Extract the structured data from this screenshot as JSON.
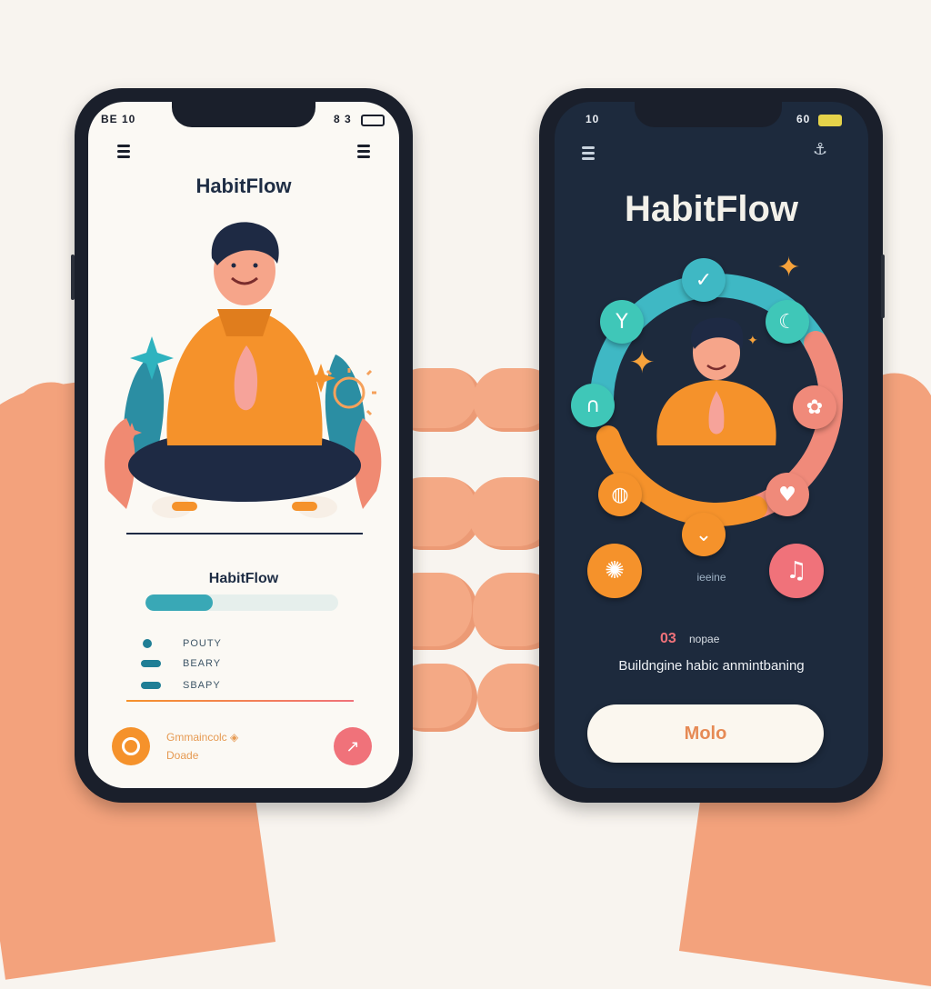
{
  "left_phone": {
    "status_time": "BE 10",
    "status_right": "8 3",
    "app_title": "HabitFlow",
    "section_title": "HabitFlow",
    "progress_fraction": 0.35,
    "list_items": [
      {
        "label": "POUTY"
      },
      {
        "label": "BEARY"
      },
      {
        "label": "SBAPY"
      }
    ],
    "footer_text_line1": "Gmmaincolc ◈",
    "footer_text_line2": "Doade",
    "icons": {
      "menu_left": "menu-icon",
      "menu_right": "menu-icon",
      "footer_left": "target-icon",
      "footer_right": "trend-icon"
    }
  },
  "right_phone": {
    "status_time": "10",
    "status_right": "60",
    "app_title": "HabitFlow",
    "ring_caption": "ieeine",
    "counter_text": "03",
    "counter_label": "nopae",
    "tagline": "Buildngine habic anmintbaning",
    "cta_label": "Molo",
    "icons": {
      "menu_left": "menu-icon",
      "top_right": "anchor-icon",
      "ring": [
        "check-icon",
        "leaf-icon",
        "headphones-icon",
        "moon-icon",
        "fan-icon",
        "kettle-icon",
        "heart-icon",
        "chevron-icon",
        "virus-icon",
        "music-icon"
      ]
    }
  },
  "colors": {
    "teal": "#39a8b6",
    "orange": "#f5922b",
    "coral": "#f0727a",
    "navy": "#1d2a3d",
    "cream": "#fbf9f4"
  }
}
